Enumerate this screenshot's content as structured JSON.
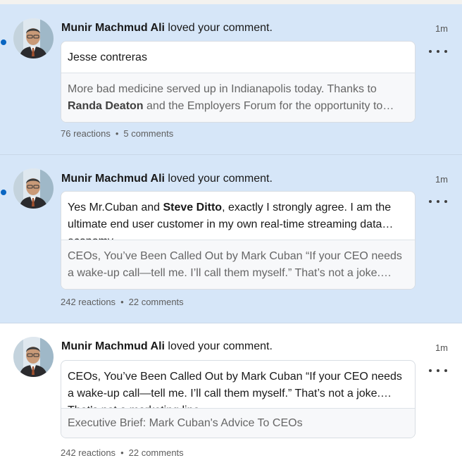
{
  "notifications": [
    {
      "actor": "Munir Machmud Ali",
      "action": "loved your comment.",
      "time": "1m",
      "comment": "Jesse contreras",
      "post_pre": "More bad medicine served up in Indianapolis today. Thanks to ",
      "post_mention": "Randa Deaton",
      "post_post": " and the Employers Forum for the opportunity to share insights on health care costs and how employers can take control",
      "reactions": "76 reactions",
      "comments": "5 comments"
    },
    {
      "actor": "Munir Machmud Ali",
      "action": "loved your comment.",
      "time": "1m",
      "comment_pre": "Yes Mr.Cuban and ",
      "comment_mention": "Steve Ditto",
      "comment_post": ", exactly I strongly agree. I am the ultimate end user customer in my own real-time streaming data economy",
      "post": "CEOs, You’ve Been Called Out by Mark Cuban “If your CEO needs a wake-up call—tell me. I’ll call them myself.” That’s not a joke. That’s not a marketing line.",
      "reactions": "242 reactions",
      "comments": "22 comments"
    },
    {
      "actor": "Munir Machmud Ali",
      "action": "loved your comment.",
      "time": "1m",
      "comment": "CEOs, You’ve Been Called Out by Mark Cuban “If your CEO needs a wake-up call—tell me. I’ll call them myself.” That’s not a joke. That’s not a marketing line.",
      "post": "Executive Brief: Mark Cuban's Advice To CEOs",
      "reactions": "242 reactions",
      "comments": "22 comments"
    }
  ],
  "colors": {
    "unread_bg": "#d6e6f8",
    "unread_dot": "#0a66c2"
  },
  "icons": {
    "more": "more-horizontal-icon"
  }
}
